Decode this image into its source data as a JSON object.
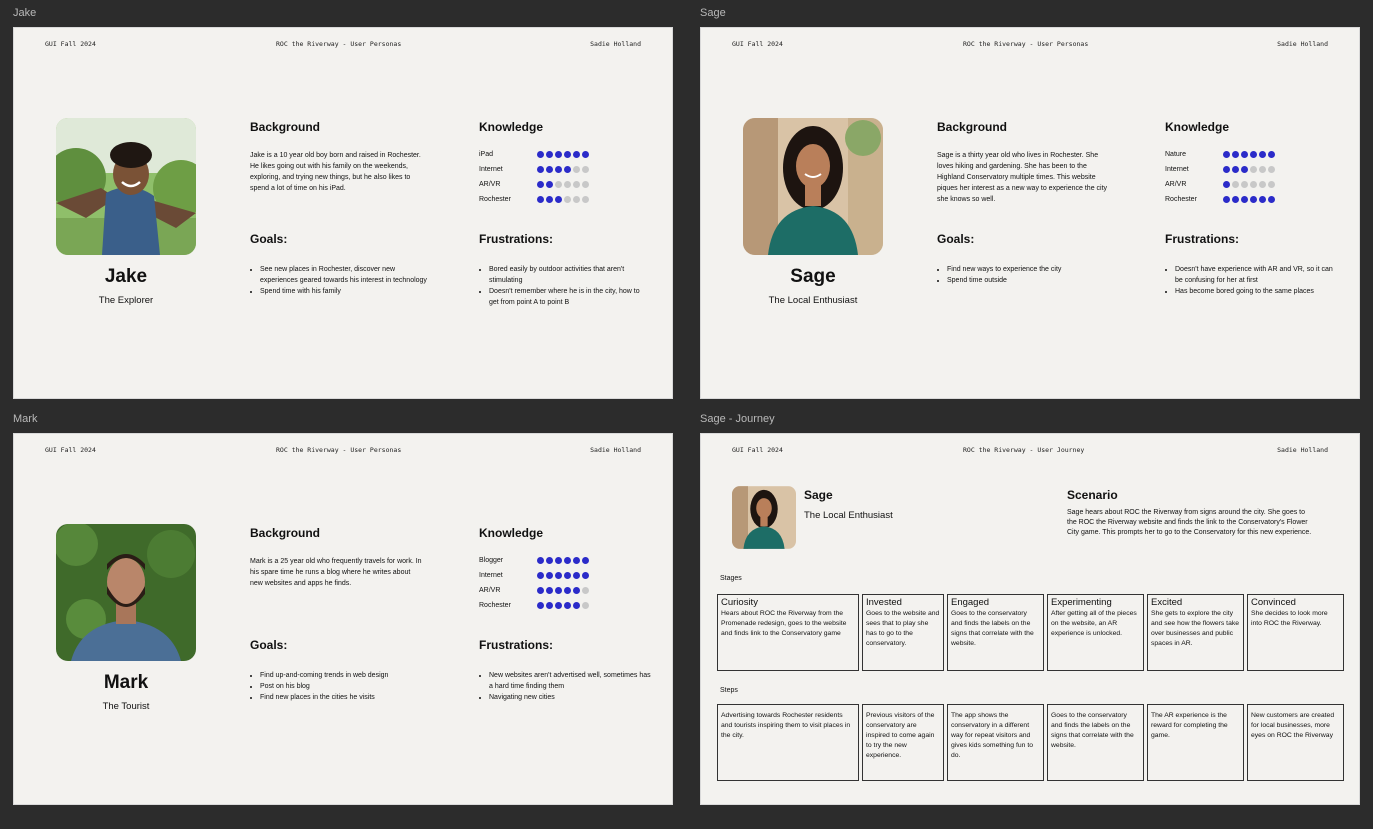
{
  "frames": {
    "jake": {
      "label": "Jake",
      "header": {
        "left": "GUI Fall 2024",
        "center": "ROC the Riverway - User Personas",
        "right": "Sadie Holland"
      },
      "name": "Jake",
      "role": "The Explorer",
      "background_title": "Background",
      "background_text": "Jake is a 10 year old boy born and raised in Rochester. He likes going out with his family on the weekends, exploring, and trying new things, but he also likes to spend a lot of time on his iPad.",
      "goals_title": "Goals:",
      "goals": [
        "See new places in Rochester, discover new experiences geared towards his interest in technology",
        "Spend time with his family"
      ],
      "knowledge_title": "Knowledge",
      "knowledge": [
        {
          "label": "iPad",
          "level": 6,
          "max": 6
        },
        {
          "label": "Internet",
          "level": 4,
          "max": 6
        },
        {
          "label": "AR/VR",
          "level": 2,
          "max": 6
        },
        {
          "label": "Rochester",
          "level": 3,
          "max": 6
        }
      ],
      "frustrations_title": "Frustrations:",
      "frustrations": [
        "Bored easily by outdoor activities that aren't stimulating",
        "Doesn't remember where he is in the city, how to get from point A to point B"
      ]
    },
    "sage": {
      "label": "Sage",
      "header": {
        "left": "GUI Fall 2024",
        "center": "ROC the Riverway - User Personas",
        "right": "Sadie Holland"
      },
      "name": "Sage",
      "role": "The Local Enthusiast",
      "background_title": "Background",
      "background_text": "Sage is a thirty year old who lives in Rochester. She loves hiking and gardening. She has been to the Highland Conservatory multiple times. This website piques her interest as a new way to experience the city she knows so well.",
      "goals_title": "Goals:",
      "goals": [
        "Find new ways to experience the city",
        "Spend time outside"
      ],
      "knowledge_title": "Knowledge",
      "knowledge": [
        {
          "label": "Nature",
          "level": 6,
          "max": 6
        },
        {
          "label": "Internet",
          "level": 3,
          "max": 6
        },
        {
          "label": "AR/VR",
          "level": 1,
          "max": 6
        },
        {
          "label": "Rochester",
          "level": 6,
          "max": 6
        }
      ],
      "frustrations_title": "Frustrations:",
      "frustrations": [
        "Doesn't have experience with AR and VR, so it can be confusing for her at first",
        "Has become bored going to the same places"
      ]
    },
    "mark": {
      "label": "Mark",
      "header": {
        "left": "GUI Fall 2024",
        "center": "ROC the Riverway - User Personas",
        "right": "Sadie Holland"
      },
      "name": "Mark",
      "role": "The Tourist",
      "background_title": "Background",
      "background_text": "Mark is a 25 year old who frequently travels for work. In his spare time he runs a blog where he writes about new websites and apps he finds.",
      "goals_title": "Goals:",
      "goals": [
        "Find up-and-coming trends in web design",
        "Post on his blog",
        "Find new places in the cities he visits"
      ],
      "knowledge_title": "Knowledge",
      "knowledge": [
        {
          "label": "Blogger",
          "level": 6,
          "max": 6
        },
        {
          "label": "Internet",
          "level": 6,
          "max": 6
        },
        {
          "label": "AR/VR",
          "level": 5,
          "max": 6
        },
        {
          "label": "Rochester",
          "level": 5,
          "max": 6
        }
      ],
      "frustrations_title": "Frustrations:",
      "frustrations": [
        "New websites aren't advertised well, sometimes has a hard time finding them",
        "Navigating new cities"
      ]
    },
    "journey": {
      "label": "Sage - Journey",
      "header": {
        "left": "GUI Fall 2024",
        "center": "ROC the Riverway - User Journey",
        "right": "Sadie Holland"
      },
      "name": "Sage",
      "role": "The Local Enthusiast",
      "scenario_title": "Scenario",
      "scenario_text": "Sage hears about ROC the Riverway from signs around the city. She goes to the ROC the Riverway website and finds the link to the Conservatory's Flower City game. This prompts her to go to the Conservatory for this new experience.",
      "stages_title": "Stages",
      "stages": [
        {
          "title": "Curiosity",
          "text": "Hears about ROC the Riverway from the Promenade redesign, goes to the website and finds link to the Conservatory game"
        },
        {
          "title": "Invested",
          "text": "Goes to the website and sees that to play she has to go to the conservatory."
        },
        {
          "title": "Engaged",
          "text": "Goes to the conservatory and finds the labels on the signs that correlate with the website."
        },
        {
          "title": "Experimenting",
          "text": "After getting all of the pieces on the website, an AR experience is unlocked."
        },
        {
          "title": "Excited",
          "text": "She gets to explore the city and see how the flowers take over businesses and public spaces in AR."
        },
        {
          "title": "Convinced",
          "text": "She decides to look more into ROC the Riverway."
        }
      ],
      "steps_title": "Steps",
      "steps": [
        "Advertising towards Rochester residents and tourists inspiring them to visit places in the city.",
        "Previous visitors of the conservatory are inspired to come again to try the new experience.",
        "The app shows the conservatory in a different way for repeat visitors and gives kids something fun to do.",
        "Goes to the conservatory and finds the labels on the signs that correlate with the website.",
        "The AR experience is the reward for completing the game.",
        "New customers are created for local businesses, more eyes on ROC the Riverway"
      ]
    }
  },
  "colors": {
    "dot_on": "#2b2bc9",
    "dot_off": "#c8c8c8",
    "canvas": "#2c2c2c",
    "frame": "#f3f2ef"
  }
}
